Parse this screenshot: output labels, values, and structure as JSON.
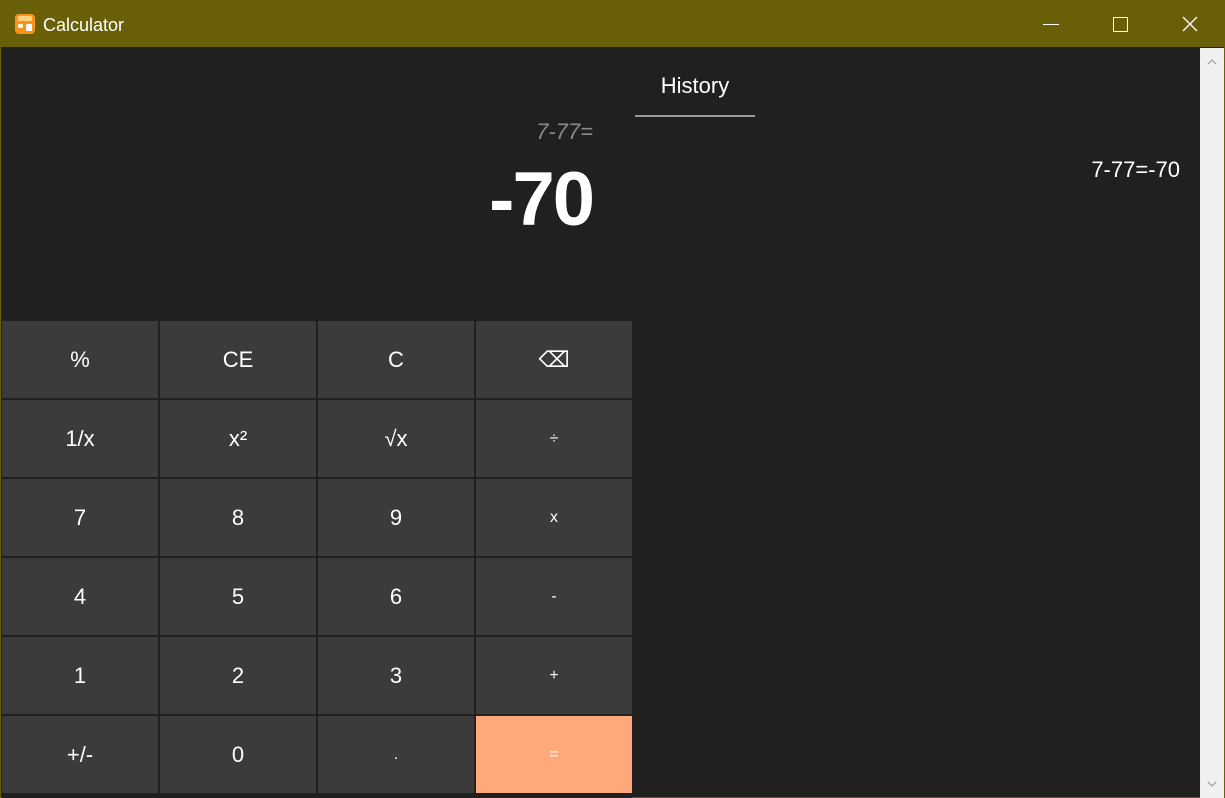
{
  "window": {
    "title": "Calculator",
    "title_bar_color": "#695f09"
  },
  "display": {
    "expression": "7-77=",
    "result": "-70"
  },
  "keypad": {
    "percent": "%",
    "clear_entry": "CE",
    "clear": "C",
    "backspace": "⌫",
    "reciprocal": "1/x",
    "square": "x²",
    "sqrt": "√x",
    "divide": "÷",
    "seven": "7",
    "eight": "8",
    "nine": "9",
    "multiply": "x",
    "four": "4",
    "five": "5",
    "six": "6",
    "minus": "-",
    "one": "1",
    "two": "2",
    "three": "3",
    "plus": "+",
    "negate": "+/-",
    "zero": "0",
    "decimal": ".",
    "equals": "=",
    "equals_color": "#ffa87a"
  },
  "history": {
    "tab_label": "History",
    "items": [
      "7-77=-70"
    ]
  },
  "icons": {
    "app": "calculator-icon",
    "minimize": "minimize-icon",
    "maximize": "maximize-icon",
    "close": "close-icon",
    "scroll_up": "chevron-up-icon",
    "scroll_down": "chevron-down-icon"
  }
}
